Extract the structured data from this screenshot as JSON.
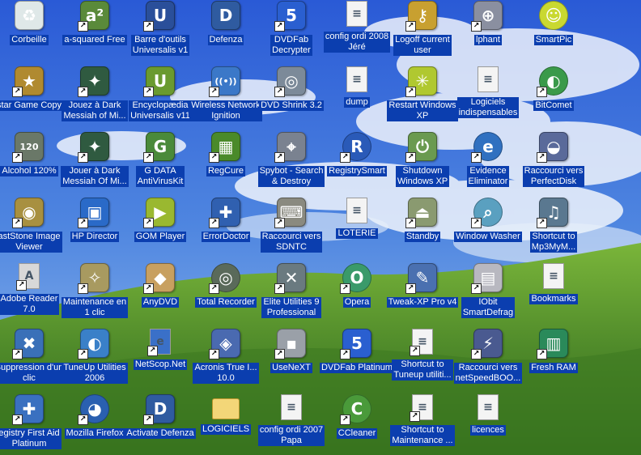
{
  "desktop": {
    "colors": {
      "label_background": "#0b3eaf",
      "label_text": "#ffffff",
      "sky": "#3a6ad0",
      "hill": "#4f8a2a"
    },
    "icons": [
      {
        "label": "Corbeille",
        "icon": "recycle-bin-icon",
        "color": "#dfe8e8",
        "glyph": "♻",
        "kind": "app",
        "shortcut": false
      },
      {
        "label": "a-squared Free",
        "icon": "a-squared-icon",
        "color": "#5a8a3a",
        "glyph": "a²",
        "kind": "app",
        "shortcut": true
      },
      {
        "label": "Barre d'outils\nUniversalis v1",
        "icon": "universalis-toolbar-icon",
        "color": "#2a4f9a",
        "glyph": "U",
        "kind": "app",
        "shortcut": true
      },
      {
        "label": "Defenza",
        "icon": "defenza-shield-icon",
        "color": "#2f5ba0",
        "glyph": "D",
        "kind": "app",
        "shortcut": false
      },
      {
        "label": "DVDFab\nDecrypter",
        "icon": "dvdfab-icon",
        "color": "#2a5fd0",
        "glyph": "5",
        "kind": "app",
        "shortcut": true
      },
      {
        "label": "config ordi 2008\nJéré",
        "icon": "text-file-icon",
        "color": "#f4f4f4",
        "glyph": "≡",
        "kind": "file",
        "shortcut": false
      },
      {
        "label": "Logoff current\nuser",
        "icon": "key-icon",
        "color": "#c8a030",
        "glyph": "⚷",
        "kind": "app",
        "shortcut": true
      },
      {
        "label": "lphant",
        "icon": "elephant-icon",
        "color": "#8a8fa0",
        "glyph": "⊕",
        "kind": "app",
        "shortcut": true
      },
      {
        "label": "SmartPic",
        "icon": "smiley-icon",
        "color": "#c9d830",
        "glyph": "☺",
        "kind": "round",
        "shortcut": false
      },
      {
        "label": "star Game Copy",
        "icon": "star-icon",
        "color": "#b08a30",
        "glyph": "★",
        "kind": "app",
        "shortcut": true
      },
      {
        "label": "Jouez à Dark\nMessiah of Mi...",
        "icon": "dragon-icon",
        "color": "#2f5a40",
        "glyph": "✦",
        "kind": "app",
        "shortcut": true
      },
      {
        "label": "Encyclopædia\nUniversalis v11",
        "icon": "universalis-icon",
        "color": "#6a9a30",
        "glyph": "U",
        "kind": "app",
        "shortcut": true
      },
      {
        "label": "Wireless Network\nIgnition",
        "icon": "wireless-icon",
        "color": "#3b78c8",
        "glyph": "((•))",
        "kind": "app",
        "shortcut": true
      },
      {
        "label": "DVD Shrink 3.2",
        "icon": "dvd-shrink-icon",
        "color": "#7c8a99",
        "glyph": "◎",
        "kind": "app",
        "shortcut": true
      },
      {
        "label": "dump",
        "icon": "text-file-icon",
        "color": "#f4f4f4",
        "glyph": "≡",
        "kind": "file",
        "shortcut": false
      },
      {
        "label": "Restart Windows\nXP",
        "icon": "restart-burst-icon",
        "color": "#b0c830",
        "glyph": "✳",
        "kind": "app",
        "shortcut": true
      },
      {
        "label": "Logiciels\nindispensables",
        "icon": "text-file-icon",
        "color": "#f4f4f4",
        "glyph": "≡",
        "kind": "file",
        "shortcut": false
      },
      {
        "label": "BitComet",
        "icon": "bitcomet-icon",
        "color": "#3a9a4a",
        "glyph": "◐",
        "kind": "round",
        "shortcut": true
      },
      {
        "label": "Alcohol 120%",
        "icon": "alcohol-icon",
        "color": "#6a7868",
        "glyph": "120",
        "kind": "app",
        "shortcut": true
      },
      {
        "label": "Jouer à Dark\nMessiah Of Mi...",
        "icon": "dragon-icon",
        "color": "#2f5a40",
        "glyph": "✦",
        "kind": "app",
        "shortcut": true
      },
      {
        "label": "G DATA\nAntiVirusKit",
        "icon": "gdata-icon",
        "color": "#4a8a3a",
        "glyph": "G",
        "kind": "app",
        "shortcut": true
      },
      {
        "label": "RegCure",
        "icon": "regcure-cubes-icon",
        "color": "#4a8a2a",
        "glyph": "▦",
        "kind": "app",
        "shortcut": true
      },
      {
        "label": "Spybot - Search\n& Destroy",
        "icon": "spybot-icon",
        "color": "#7a8290",
        "glyph": "⌖",
        "kind": "app",
        "shortcut": true
      },
      {
        "label": "RegistrySmart",
        "icon": "registrysmart-icon",
        "color": "#2a5ab8",
        "glyph": "R",
        "kind": "round",
        "shortcut": true
      },
      {
        "label": "Shutdown\nWindows XP",
        "icon": "power-icon",
        "color": "#6a9a50",
        "glyph": "⏻",
        "kind": "app",
        "shortcut": true
      },
      {
        "label": "Evidence\nEliminator",
        "icon": "evidence-eliminator-icon",
        "color": "#3070c0",
        "glyph": "e",
        "kind": "round",
        "shortcut": true
      },
      {
        "label": "Raccourci vers\nPerfectDisk",
        "icon": "perfectdisk-icon",
        "color": "#5a6a9a",
        "glyph": "◒",
        "kind": "app",
        "shortcut": true
      },
      {
        "label": "astStone Image\nViewer",
        "icon": "eye-icon",
        "color": "#a89040",
        "glyph": "◉",
        "kind": "app",
        "shortcut": true
      },
      {
        "label": "HP Director",
        "icon": "hp-director-icon",
        "color": "#2a6ac8",
        "glyph": "▣",
        "kind": "app",
        "shortcut": true
      },
      {
        "label": "GOM Player",
        "icon": "gom-player-icon",
        "color": "#9ab830",
        "glyph": "▶",
        "kind": "app",
        "shortcut": true
      },
      {
        "label": "ErrorDoctor",
        "icon": "error-doctor-icon",
        "color": "#3060b0",
        "glyph": "✚",
        "kind": "app",
        "shortcut": true
      },
      {
        "label": "Raccourci vers\nSDNTC",
        "icon": "sdntc-keyboard-icon",
        "color": "#8a8a80",
        "glyph": "⌨",
        "kind": "app",
        "shortcut": true
      },
      {
        "label": "LOTERIE",
        "icon": "text-file-icon",
        "color": "#f4f4f4",
        "glyph": "≡",
        "kind": "file",
        "shortcut": false
      },
      {
        "label": "Standby",
        "icon": "standby-icon",
        "color": "#8a9a70",
        "glyph": "⏏",
        "kind": "app",
        "shortcut": true
      },
      {
        "label": "Window Washer",
        "icon": "magnifier-icon",
        "color": "#5aa0c0",
        "glyph": "⌕",
        "kind": "round",
        "shortcut": true
      },
      {
        "label": "Shortcut to\nMp3MyM...",
        "icon": "mp3mym-icon",
        "color": "#5a7890",
        "glyph": "♫",
        "kind": "app",
        "shortcut": true
      },
      {
        "label": "Adobe Reader\n7.0",
        "icon": "adobe-reader-icon",
        "color": "#d8d8d8",
        "glyph": "A",
        "kind": "file",
        "shortcut": true
      },
      {
        "label": "Maintenance en\n1 clic",
        "icon": "wizard-icon",
        "color": "#a89a60",
        "glyph": "✧",
        "kind": "app",
        "shortcut": true
      },
      {
        "label": "AnyDVD",
        "icon": "fox-icon",
        "color": "#c8a060",
        "glyph": "◆",
        "kind": "app",
        "shortcut": true
      },
      {
        "label": "Total Recorder",
        "icon": "total-recorder-icon",
        "color": "#5a6a5a",
        "glyph": "◎",
        "kind": "round",
        "shortcut": true
      },
      {
        "label": "Elite Utilities 9\nProfessional",
        "icon": "tools-icon",
        "color": "#6a7a80",
        "glyph": "✕",
        "kind": "app",
        "shortcut": true
      },
      {
        "label": "Opera",
        "icon": "opera-icon",
        "color": "#3a9a6a",
        "glyph": "O",
        "kind": "round",
        "shortcut": true
      },
      {
        "label": "Tweak-XP Pro v4",
        "icon": "tweak-xp-icon",
        "color": "#4a70b0",
        "glyph": "✎",
        "kind": "app",
        "shortcut": true
      },
      {
        "label": "IObit\nSmartDefrag",
        "icon": "smartdefrag-icon",
        "color": "#b8b8c0",
        "glyph": "▤",
        "kind": "app",
        "shortcut": true
      },
      {
        "label": "Bookmarks",
        "icon": "text-file-icon",
        "color": "#f4f4f4",
        "glyph": "≡",
        "kind": "file",
        "shortcut": false
      },
      {
        "label": "Suppression d'un\nclic",
        "icon": "suppression-icon",
        "color": "#3a70b8",
        "glyph": "✖",
        "kind": "app",
        "shortcut": true
      },
      {
        "label": "TuneUp Utilities\n2006",
        "icon": "tuneup-icon",
        "color": "#3a80c8",
        "glyph": "◐",
        "kind": "app",
        "shortcut": true
      },
      {
        "label": "NetScop.Net",
        "icon": "netscop-icon",
        "color": "#3a70c8",
        "glyph": "e",
        "kind": "file",
        "shortcut": true
      },
      {
        "label": "Acronis True I...\n10.0",
        "icon": "acronis-icon",
        "color": "#4a6ab0",
        "glyph": "◈",
        "kind": "app",
        "shortcut": true
      },
      {
        "label": "UseNeXT",
        "icon": "usenext-icon",
        "color": "#9aa0a8",
        "glyph": "▪",
        "kind": "app",
        "shortcut": true
      },
      {
        "label": "DVDFab Platinum",
        "icon": "dvdfab-icon",
        "color": "#2a5fd0",
        "glyph": "5",
        "kind": "app",
        "shortcut": true
      },
      {
        "label": "Shortcut to\nTuneup utiliti...",
        "icon": "document-shortcut-icon",
        "color": "#f4f4f4",
        "glyph": "≡",
        "kind": "file",
        "shortcut": true
      },
      {
        "label": "Raccourci vers\nnetSpeedBOO...",
        "icon": "netspeedboost-icon",
        "color": "#4a5a90",
        "glyph": "⚡",
        "kind": "app",
        "shortcut": true
      },
      {
        "label": "Fresh RAM",
        "icon": "fresh-ram-icon",
        "color": "#2a8a5a",
        "glyph": "▥",
        "kind": "app",
        "shortcut": true
      },
      {
        "label": "egistry First Aid\nPlatinum",
        "icon": "first-aid-icon",
        "color": "#3a70c0",
        "glyph": "✚",
        "kind": "app",
        "shortcut": true
      },
      {
        "label": "Mozilla Firefox",
        "icon": "firefox-icon",
        "color": "#2a60b0",
        "glyph": "◕",
        "kind": "round",
        "shortcut": true
      },
      {
        "label": "Activate Defenza",
        "icon": "defenza-shield-icon",
        "color": "#2f5ba0",
        "glyph": "D",
        "kind": "app",
        "shortcut": true
      },
      {
        "label": "LOGICIELS",
        "icon": "folder-icon",
        "color": "#f3d678",
        "glyph": "",
        "kind": "folder",
        "shortcut": false
      },
      {
        "label": "config ordi 2007\nPapa",
        "icon": "text-file-icon",
        "color": "#f4f4f4",
        "glyph": "≡",
        "kind": "file",
        "shortcut": false
      },
      {
        "label": "CCleaner",
        "icon": "ccleaner-icon",
        "color": "#4a9a3a",
        "glyph": "C",
        "kind": "round",
        "shortcut": true
      },
      {
        "label": "Shortcut to\nMaintenance ...",
        "icon": "document-shortcut-icon",
        "color": "#f4f4f4",
        "glyph": "≡",
        "kind": "file",
        "shortcut": true
      },
      {
        "label": "licences",
        "icon": "text-file-icon",
        "color": "#f4f4f4",
        "glyph": "≡",
        "kind": "file",
        "shortcut": false
      }
    ]
  }
}
